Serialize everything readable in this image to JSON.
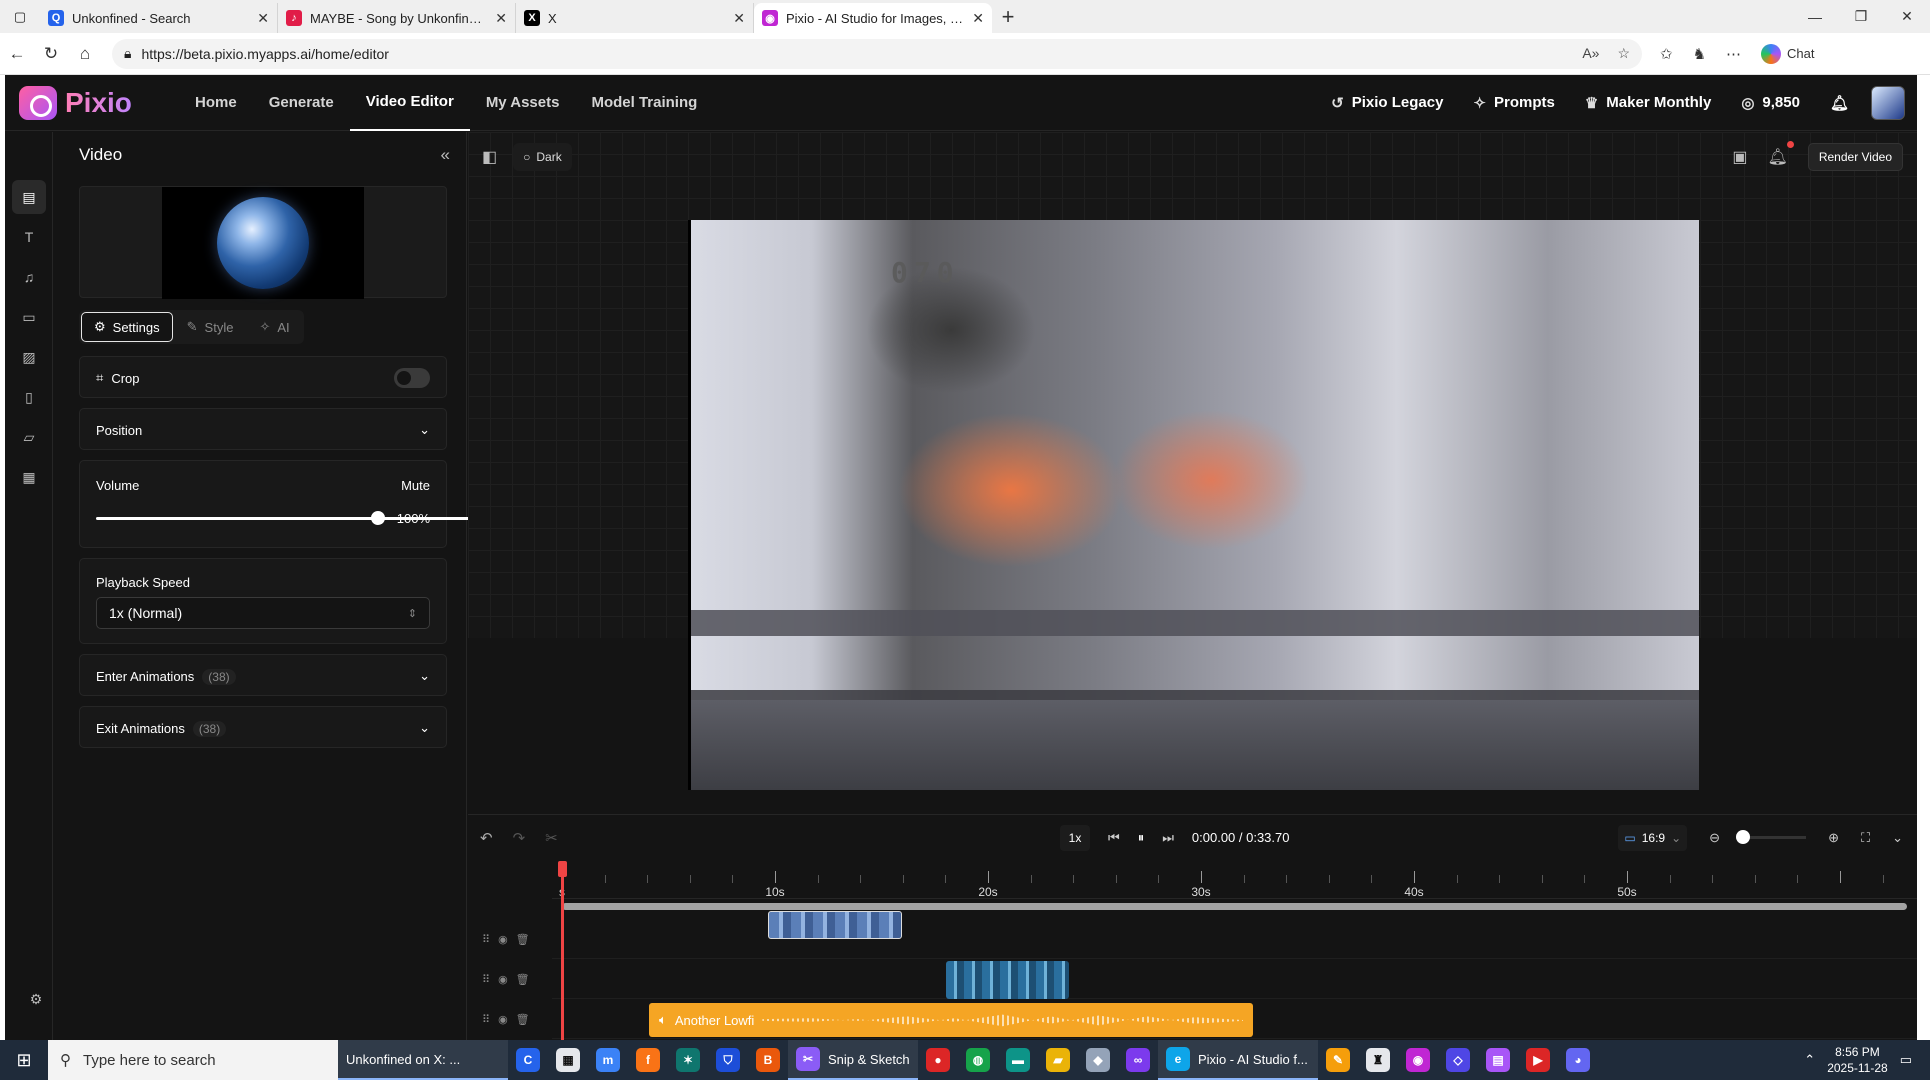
{
  "browser": {
    "tabs": [
      {
        "title": "Unkonfined - Search",
        "icon": "search-icon",
        "color": "#2563eb"
      },
      {
        "title": "MAYBE - Song by Unkonfined - A",
        "icon": "spotify-icon",
        "color": "#e11d48"
      },
      {
        "title": "X",
        "icon": "x-icon",
        "color": "#000000"
      },
      {
        "title": "Pixio - AI Studio for Images, Vide",
        "icon": "pixio-icon",
        "color": "#c026d3"
      }
    ],
    "url": "https://beta.pixio.myapps.ai/home/editor",
    "chat_label": "Chat"
  },
  "app": {
    "logo_text": "Pixio",
    "nav": [
      "Home",
      "Generate",
      "Video Editor",
      "My Assets",
      "Model Training"
    ],
    "nav_active": "Video Editor",
    "nav_right": {
      "legacy": "Pixio Legacy",
      "prompts": "Prompts",
      "plan": "Maker Monthly",
      "credits": "9,850"
    },
    "panel": {
      "title": "Video",
      "tabs": [
        "Settings",
        "Style",
        "AI"
      ],
      "crop_label": "Crop",
      "position_label": "Position",
      "volume_label": "Volume",
      "mute_label": "Mute",
      "volume_value": "100%",
      "volume_fraction": 1.0,
      "playback_label": "Playback Speed",
      "playback_value": "1x (Normal)",
      "enter_label": "Enter Animations",
      "enter_count": "(38)",
      "exit_label": "Exit Animations",
      "exit_count": "(38)"
    },
    "stage": {
      "theme_label": "Dark",
      "render_label": "Render Video",
      "overlay_counter": "070"
    },
    "player": {
      "speed": "1x",
      "time": "0:00.00 / 0:33.70",
      "aspect": "16:9"
    },
    "timeline": {
      "ticks": [
        "s",
        "10s",
        "20s",
        "30s",
        "40s",
        "50s"
      ],
      "audio_clip_label": "Another Lowfi"
    }
  },
  "taskbar": {
    "search_placeholder": "Type here to search",
    "items": [
      {
        "label": "Unkonfined on X: ...",
        "icon": "x-icon",
        "color": "#111111"
      },
      {
        "label": "Snip & Sketch",
        "icon": "snip-icon",
        "color": "#8b5cf6"
      },
      {
        "label": "Pixio - AI Studio f...",
        "icon": "edge-icon",
        "color": "#0ea5e9"
      }
    ],
    "time": "8:56 PM",
    "date": "2025-11-28"
  }
}
